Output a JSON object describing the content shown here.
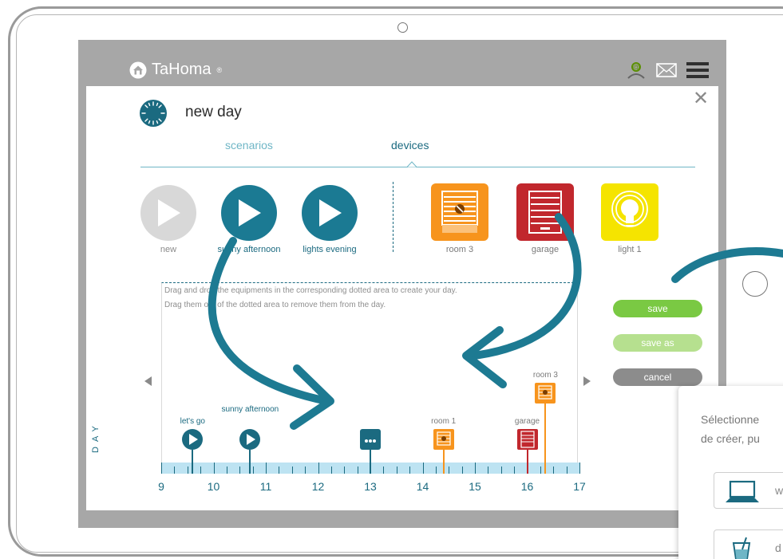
{
  "app": {
    "logo_text": "TaHoma",
    "logo_reg": "®"
  },
  "header_icons": [
    "account-icon",
    "mail-icon",
    "menu-icon"
  ],
  "modal": {
    "title": "new day",
    "close_glyph": "✕",
    "tabs": [
      {
        "label": "scenarios",
        "active": false
      },
      {
        "label": "devices",
        "active": true
      }
    ],
    "scenarios": [
      {
        "label": "new",
        "color": "#d8d8d8"
      },
      {
        "label": "sunny afternoon",
        "color": "#1b7a93"
      },
      {
        "label": "lights evening",
        "color": "#1b7a93"
      }
    ],
    "devices": [
      {
        "label": "room 3",
        "icon": "shutter-icon",
        "color": "#f7941d"
      },
      {
        "label": "garage",
        "icon": "garage-door-icon",
        "color": "#c1272d"
      },
      {
        "label": "light 1",
        "icon": "bulb-icon",
        "color": "#f5e400"
      }
    ],
    "hint_line1": "Drag and drop the equipments in the corresponding dotted area to create your day.",
    "hint_line2": "Drag them out of the dotted area to remove them from the day.",
    "buttons": {
      "save": "save",
      "save_as": "save as",
      "cancel": "cancel"
    },
    "day_label": "DAY",
    "timeline": {
      "hours": [
        "9",
        "10",
        "11",
        "12",
        "13",
        "14",
        "15",
        "16",
        "17"
      ],
      "markers": [
        {
          "label": "let's go",
          "time": 9.6,
          "type": "scenario"
        },
        {
          "label": "sunny afternoon",
          "time": 10.7,
          "type": "scenario"
        },
        {
          "label": "",
          "time": 13.0,
          "type": "more"
        },
        {
          "label": "room 1",
          "time": 14.4,
          "type": "shutter"
        },
        {
          "label": "garage",
          "time": 16.0,
          "type": "garage"
        },
        {
          "label": "room 3",
          "time": 16.35,
          "type": "shutter"
        }
      ],
      "more_glyph": "•••"
    }
  },
  "popup": {
    "line1": "Sélectionne",
    "line2": "de créer, pu",
    "items": [
      {
        "icon": "laptop-icon",
        "label": "w"
      },
      {
        "icon": "drink-icon",
        "label": "d"
      }
    ]
  }
}
